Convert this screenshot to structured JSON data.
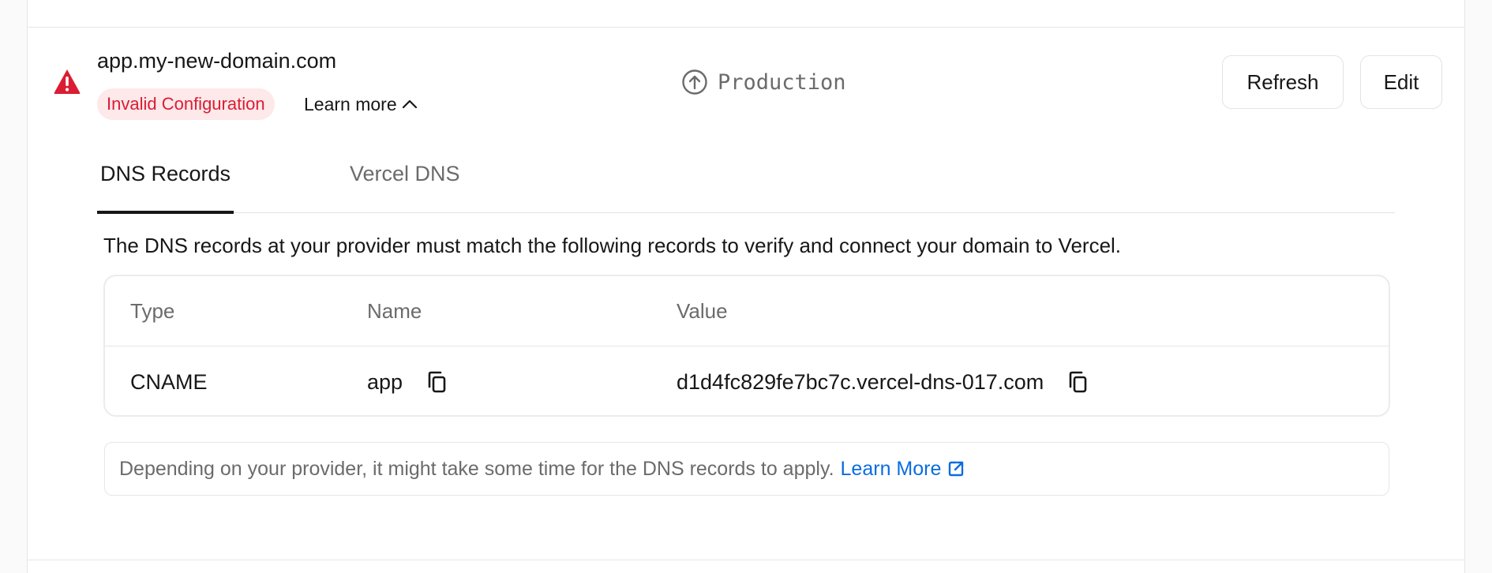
{
  "domain": {
    "name": "app.my-new-domain.com",
    "status_badge": "Invalid Configuration",
    "learn_more_toggle": "Learn more",
    "environment": "Production"
  },
  "actions": {
    "refresh_label": "Refresh",
    "edit_label": "Edit"
  },
  "tabs": [
    {
      "label": "DNS Records",
      "active": true
    },
    {
      "label": "Vercel DNS",
      "active": false
    }
  ],
  "description": "The DNS records at your provider must match the following records to verify and connect your domain to Vercel.",
  "records_table": {
    "headers": [
      "Type",
      "Name",
      "Value"
    ],
    "rows": [
      {
        "type": "CNAME",
        "name": "app",
        "value": "d1d4fc829fe7bc7c.vercel-dns-017.com"
      }
    ]
  },
  "note": {
    "text": "Depending on your provider, it might take some time for the DNS records to apply.",
    "link_label": "Learn More"
  },
  "icons": {
    "status": "warning-triangle-icon",
    "environment": "arrow-up-circle-icon",
    "toggle": "chevron-up-icon",
    "copy": "copy-icon",
    "external": "external-link-icon"
  },
  "colors": {
    "error": "#da1d32",
    "error_bg": "#fde8ea",
    "link": "#0a6cdf",
    "text": "#171717",
    "muted": "#6b6b6b"
  }
}
